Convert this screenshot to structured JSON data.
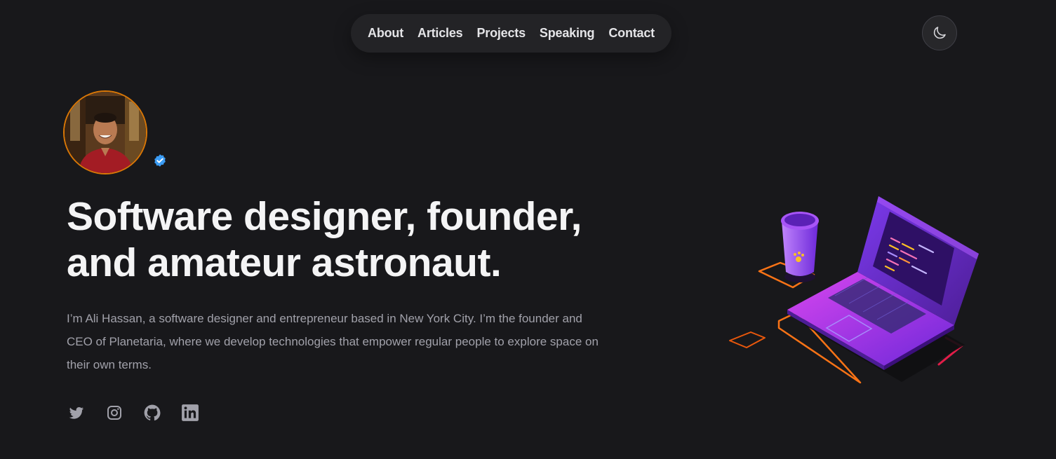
{
  "nav": {
    "items": [
      {
        "label": "About"
      },
      {
        "label": "Articles"
      },
      {
        "label": "Projects"
      },
      {
        "label": "Speaking"
      },
      {
        "label": "Contact"
      }
    ]
  },
  "theme_toggle": {
    "icon": "moon-icon"
  },
  "profile": {
    "avatar_icon": "avatar",
    "verified_icon": "verified-badge-icon",
    "verified_color": "#3b9cf5",
    "ring_color": "#d97706"
  },
  "hero": {
    "headline_line1": "Software designer, founder,",
    "headline_line2": "and amateur astronaut.",
    "bio": "I’m Ali Hassan, a software designer and entrepreneur based in New York City. I’m the founder and CEO of Planetaria, where we develop technologies that empower regular people to explore space on their own terms."
  },
  "social": [
    {
      "icon": "twitter-icon"
    },
    {
      "icon": "instagram-icon"
    },
    {
      "icon": "github-icon"
    },
    {
      "icon": "linkedin-icon"
    }
  ],
  "illustration": {
    "icon": "laptop-coffee-illustration"
  },
  "colors": {
    "background": "#18181b",
    "accent_purple": "#8b5cf6",
    "accent_orange": "#f97316",
    "text_muted": "#a1a1aa"
  }
}
